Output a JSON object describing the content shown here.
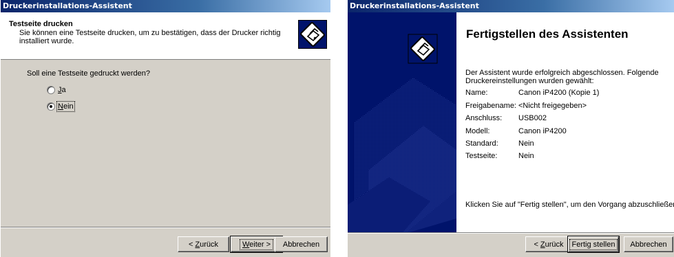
{
  "left_window": {
    "title": "Druckerinstallations-Assistent",
    "header_title": "Testseite drucken",
    "header_subtitle": "Sie können eine Testseite drucken, um zu bestätigen, dass der Drucker richtig installiert wurde.",
    "header_icon": "printer-icon",
    "question": "Soll eine Testseite gedruckt werden?",
    "options": [
      {
        "mnemonic": "J",
        "rest": "a",
        "checked": false
      },
      {
        "mnemonic": "N",
        "rest": "ein",
        "checked": true
      }
    ],
    "buttons": {
      "back_prefix": "< ",
      "back_mnemonic": "Z",
      "back_rest": "urück",
      "next_mnemonic": "W",
      "next_rest": "eiter >",
      "cancel": "Abbrechen"
    }
  },
  "right_window": {
    "title": "Druckerinstallations-Assistent",
    "finish_title": "Fertigstellen des Assistenten",
    "intro": "Der Assistent wurde erfolgreich abgeschlossen. Folgende Druckereinstellungen wurden gewählt:",
    "settings": [
      {
        "label": "Name:",
        "value": "Canon iP4200 (Kopie 1)"
      },
      {
        "label": "Freigabename:",
        "value": "<Nicht freigegeben>"
      },
      {
        "label": "Anschluss:",
        "value": "USB002"
      },
      {
        "label": "Modell:",
        "value": "Canon iP4200"
      },
      {
        "label": "Standard:",
        "value": "Nein"
      },
      {
        "label": "Testseite:",
        "value": "Nein"
      }
    ],
    "closing": "Klicken Sie auf \"Fertig stellen\", um den Vorgang abzuschließen.",
    "side_icon": "printer-icon",
    "buttons": {
      "back_prefix": "< ",
      "back_mnemonic": "Z",
      "back_rest": "urück",
      "finish": "Fertig stellen",
      "cancel": "Abbrechen"
    }
  },
  "colors": {
    "title_gradient_start": "#0a246a",
    "side_panel": "#00136b",
    "dialog_face": "#d4d0c8"
  }
}
